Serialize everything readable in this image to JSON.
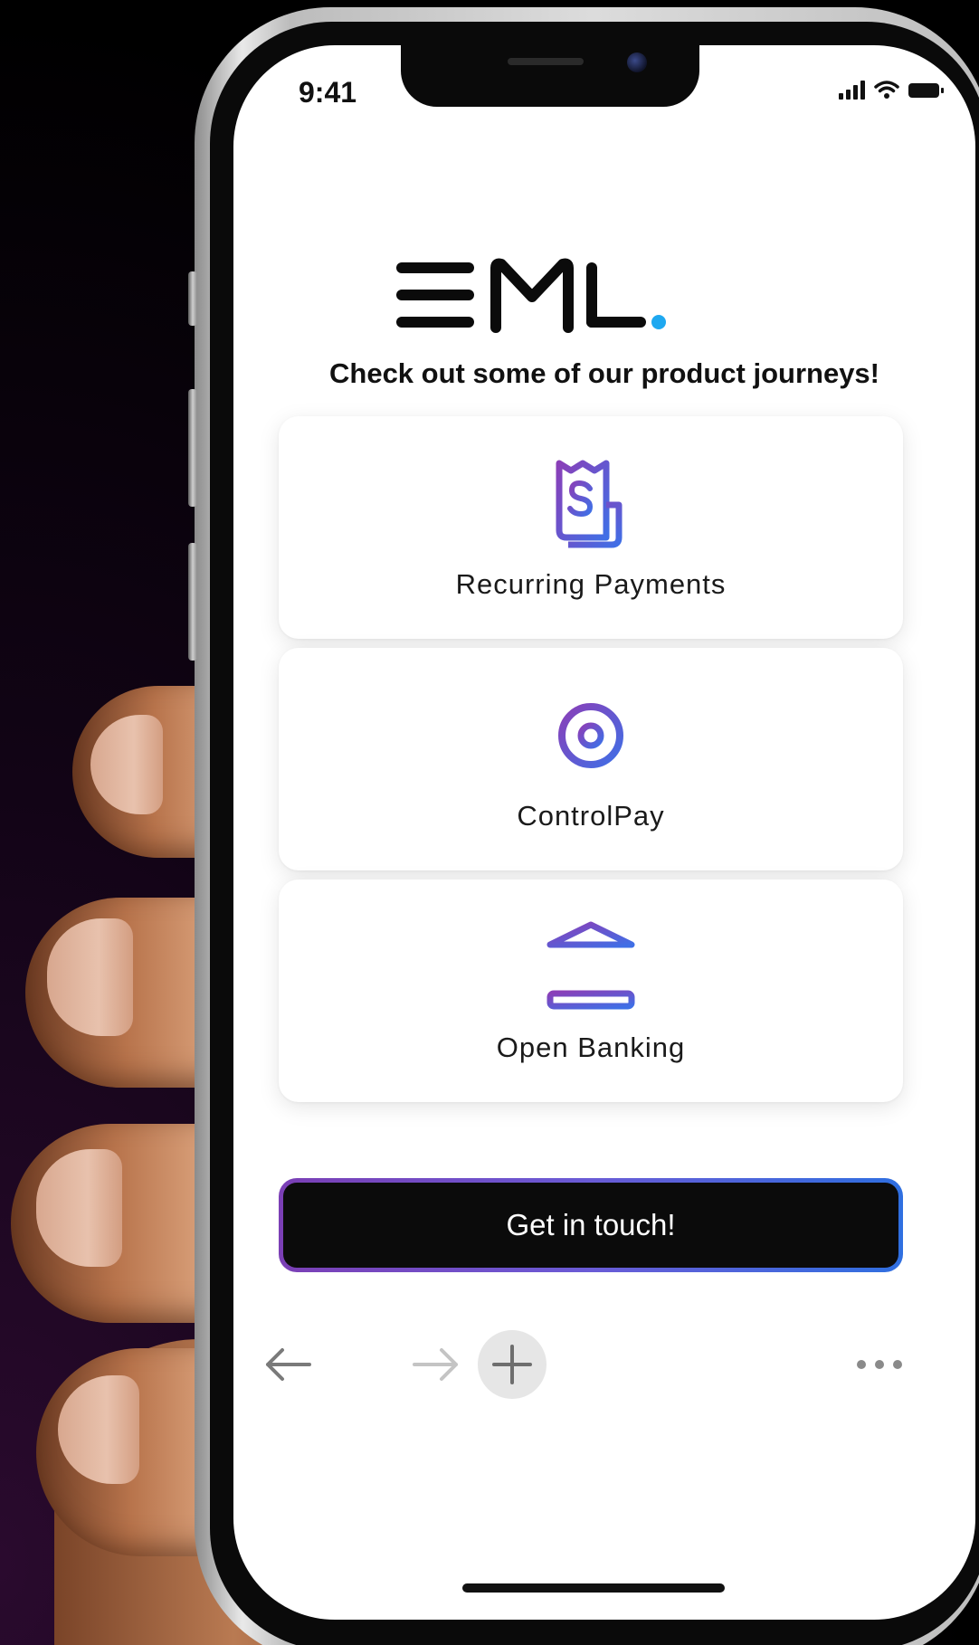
{
  "status_bar": {
    "time": "9:41"
  },
  "brand": {
    "logo_text": "EML",
    "accent_color": "#1ea8f0"
  },
  "header": {
    "tagline": "Check out some of our product journeys!"
  },
  "products": [
    {
      "label": "Recurring Payments",
      "icon": "receipt-dollar-icon"
    },
    {
      "label": "ControlPay",
      "icon": "target-icon"
    },
    {
      "label": "Open Banking",
      "icon": "bank-icon"
    }
  ],
  "cta": {
    "label": "Get in touch!"
  },
  "browser_toolbar": {
    "back_icon": "arrow-left-icon",
    "forward_icon": "arrow-right-icon",
    "new_tab_icon": "plus-icon",
    "more_icon": "more-dots-icon"
  },
  "colors": {
    "icon_gradient_start": "#3f6fe6",
    "icon_gradient_end": "#8a3fb8",
    "cta_background": "#0b0b0b"
  }
}
